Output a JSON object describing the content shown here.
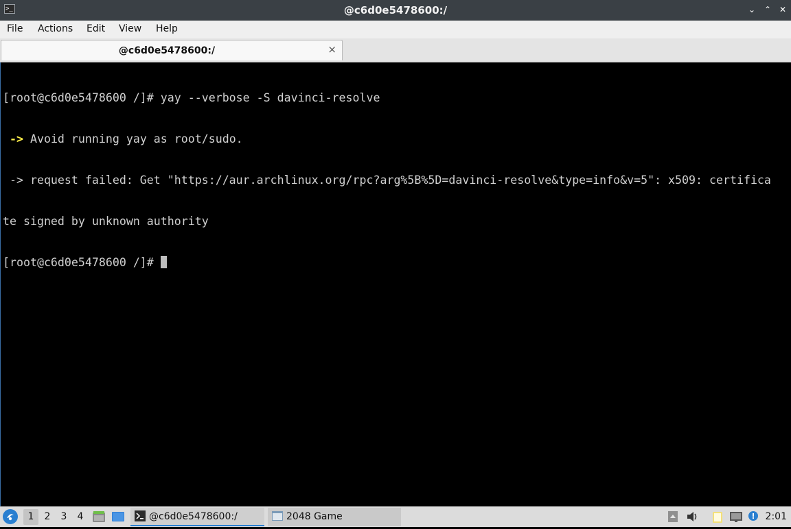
{
  "window": {
    "title": "@c6d0e5478600:/",
    "app_icon_text": ">_",
    "controls": {
      "minimize": "⌄",
      "maximize": "⌃",
      "close": "✕"
    }
  },
  "menu": [
    "File",
    "Actions",
    "Edit",
    "View",
    "Help"
  ],
  "tabs": [
    {
      "label": "@c6d0e5478600:/",
      "close": "×"
    }
  ],
  "terminal": {
    "lines": [
      {
        "prefix": "",
        "text": "[root@c6d0e5478600 /]# yay --verbose -S davinci-resolve"
      },
      {
        "prefix": " ->",
        "text": " Avoid running yay as root/sudo."
      },
      {
        "prefix": "",
        "text": " -> request failed: Get \"https://aur.archlinux.org/rpc?arg%5B%5D=davinci-resolve&type=info&v=5\": x509: certifica"
      },
      {
        "prefix": "",
        "text": "te signed by unknown authority"
      },
      {
        "prefix": "",
        "text": "[root@c6d0e5478600 /]# "
      }
    ]
  },
  "taskbar": {
    "workspaces": [
      "1",
      "2",
      "3",
      "4"
    ],
    "active_workspace": "1",
    "tasks": [
      {
        "label": "@c6d0e5478600:/",
        "icon": "terminal-icon",
        "active": true
      },
      {
        "label": "2048 Game",
        "icon": "window-icon",
        "active": false
      }
    ],
    "clock": "2:01"
  },
  "colors": {
    "titlebar": "#3a4045",
    "terminal_bg": "#000000",
    "terminal_fg": "#d0d0d0",
    "arrow": "#ffef4a",
    "accent": "#2a7fd0"
  }
}
